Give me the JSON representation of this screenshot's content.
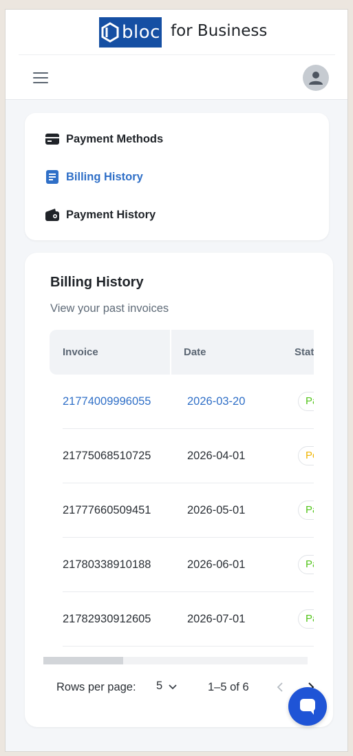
{
  "header": {
    "logo_text": "bloc",
    "logo_suffix": "for Business",
    "brand_color": "#154fa3",
    "menu_icon": "hamburger-menu-icon",
    "avatar_icon": "user-avatar-icon"
  },
  "nav": {
    "items": [
      {
        "label": "Payment Methods",
        "icon": "credit-card-icon",
        "active": false
      },
      {
        "label": "Billing History",
        "icon": "document-icon",
        "active": true
      },
      {
        "label": "Payment History",
        "icon": "wallet-icon",
        "active": false
      }
    ],
    "active_color": "#2f6fc7"
  },
  "billing": {
    "title": "Billing History",
    "subtitle": "View your past invoices",
    "columns": [
      "Invoice",
      "Date",
      "Stat"
    ],
    "rows": [
      {
        "invoice": "21774009996055",
        "date": "2026-03-20",
        "status": "Pa",
        "status_color": "#52c41a",
        "is_link": true
      },
      {
        "invoice": "21775068510725",
        "date": "2026-04-01",
        "status": "Pe",
        "status_color": "#f0b400",
        "is_link": false
      },
      {
        "invoice": "21777660509451",
        "date": "2026-05-01",
        "status": "Pa",
        "status_color": "#52c41a",
        "is_link": false
      },
      {
        "invoice": "21780338910188",
        "date": "2026-06-01",
        "status": "Pa",
        "status_color": "#52c41a",
        "is_link": false
      },
      {
        "invoice": "21782930912605",
        "date": "2026-07-01",
        "status": "Pa",
        "status_color": "#52c41a",
        "is_link": false
      }
    ],
    "pagination": {
      "rows_per_page_label": "Rows per page:",
      "rows_per_page_value": "5",
      "range": "1–5 of 6"
    }
  },
  "chat": {
    "icon": "chat-bubble-icon",
    "color": "#1f54d6"
  }
}
